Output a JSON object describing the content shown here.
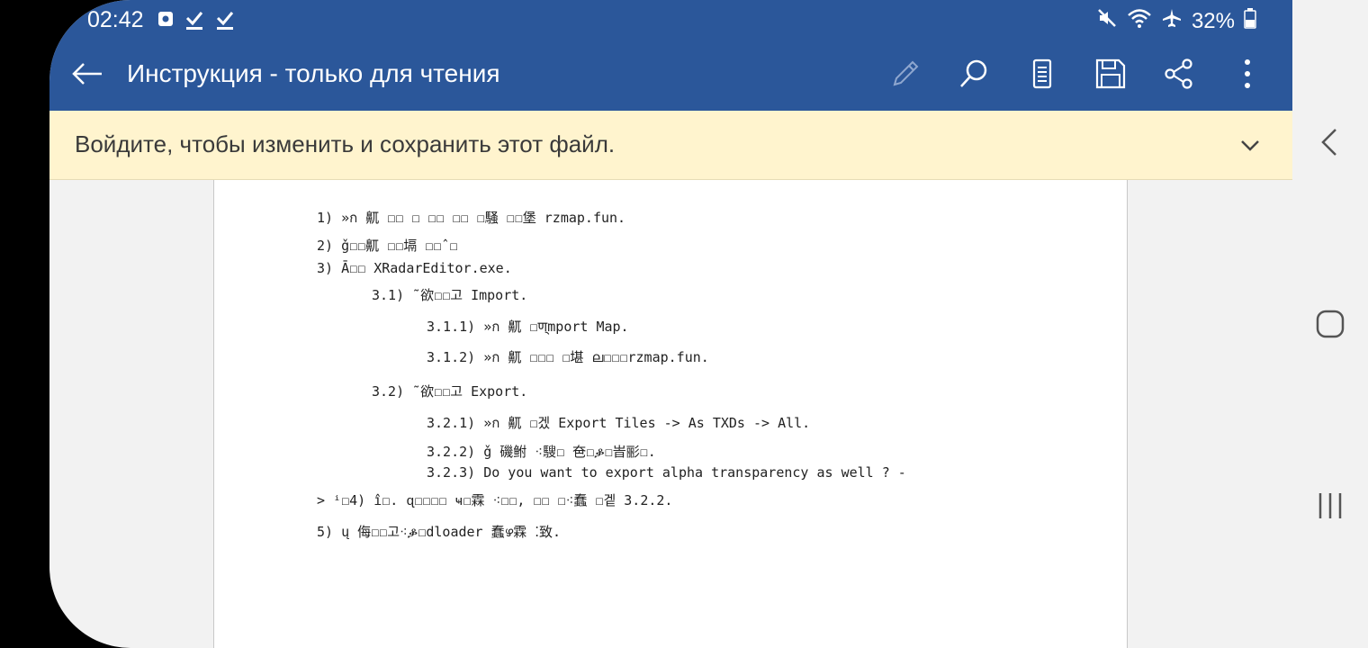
{
  "status_bar": {
    "time": "02:42",
    "battery": "32%",
    "left_icons": [
      "notification-icon",
      "check-icon",
      "check-icon"
    ],
    "right_icons": [
      "mute-icon",
      "wifi-icon",
      "airplane-icon",
      "battery-icon"
    ]
  },
  "app_bar": {
    "title": "Инструкция - только для чтения",
    "icons": [
      "edit-icon",
      "search-icon",
      "reading-mode-icon",
      "save-icon",
      "share-icon",
      "more-icon"
    ]
  },
  "banner": {
    "text": "Войдите, чтобы изменить и сохранить этот файл."
  },
  "document": {
    "lines": [
      "1) »ก 鼿 ☐☐ ☐ ☐☐ ☐☐ ☐騒 ☐☐堡 rzmap.fun.",
      "2) ǧ☐☐鼿 ☐☐塥 ☐☐ˆ☐",
      "3) Ā☐☐ XRadarEditor.exe.",
      "3.1) ˜欲☐☐고 Import.",
      "3.1.1) »ก 鼿 ☐ण्mport Map.",
      "3.1.2) »ก 鼿 ☐☐☐ ☐堪 ല☐☐☐rzmap.fun.",
      "3.2) ˜欲☐☐고 Export.",
      "3.2.1) »ก 鼿 ☐겠 Export Tiles -> As TXDs -> All.",
      "3.2.2) ǧ 磯鲋 ⁖騪☐ 夿☐ቇ☐峕彨☐.",
      "3.2.3) Do you want to export alpha transparency as well ? -",
      "> ⁱ☐4) î☐. ɋ☐☐☐☐ ҹ☐霖 ⁖☐☐, ☐☐ ☐⁖蠢 ☐겥 3.2.2.",
      "5) ų 侮☐☐고⁖ቇ☐dloader 蠢ഴ霖 ⁚致."
    ]
  },
  "nav_buttons": [
    "back-nav-icon",
    "home-nav-icon",
    "recents-nav-icon"
  ]
}
